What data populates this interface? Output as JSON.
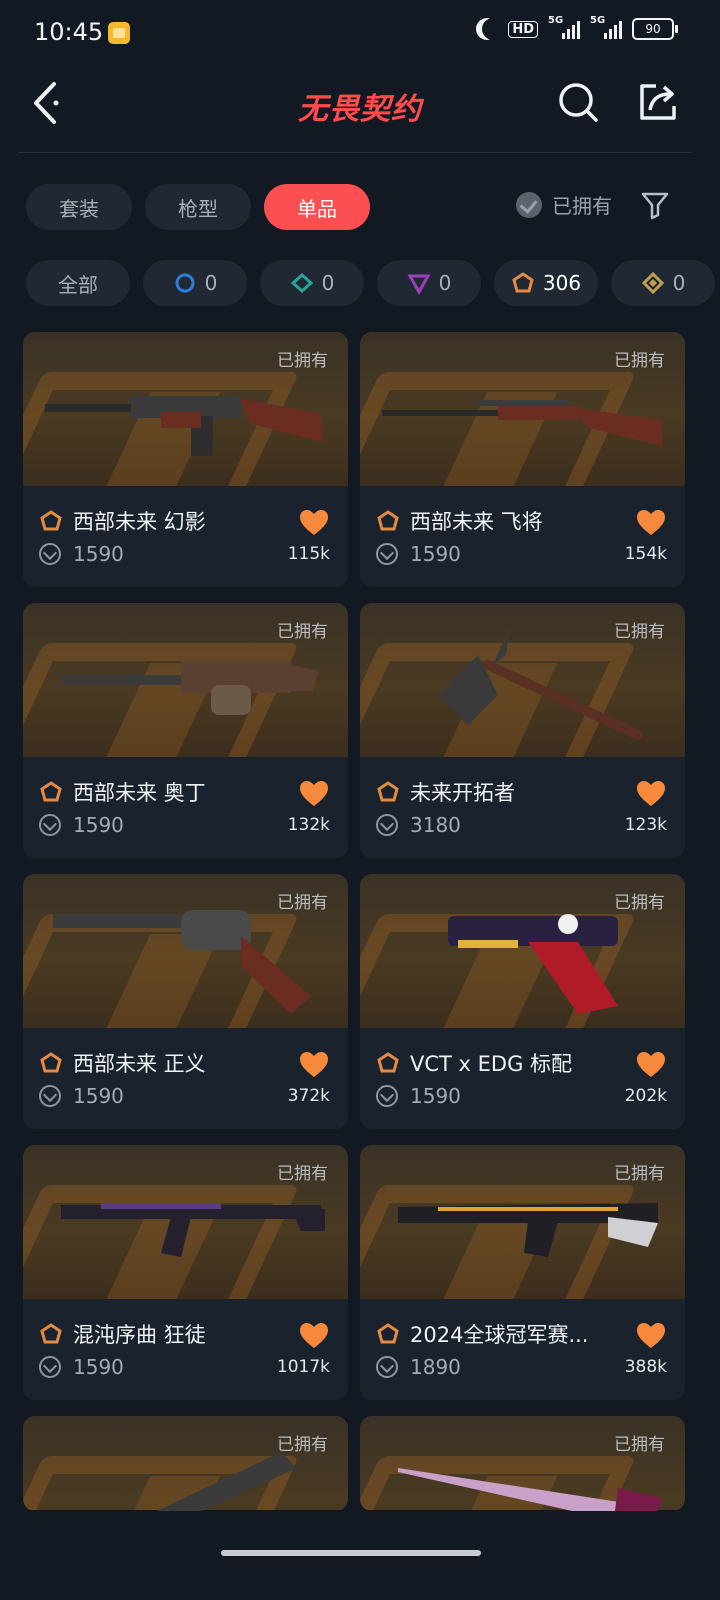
{
  "status_bar": {
    "time": "10:45",
    "hd": "HD",
    "sig1": "5G",
    "sig2": "5G",
    "battery": "90"
  },
  "header": {
    "title": "无畏契约"
  },
  "tabs": [
    {
      "label": "套装",
      "active": false
    },
    {
      "label": "枪型",
      "active": false
    },
    {
      "label": "单品",
      "active": true
    }
  ],
  "owned_filter": {
    "label": "已拥有"
  },
  "tiers": [
    {
      "label": "全部",
      "count": ""
    },
    {
      "label": "",
      "count": "0",
      "color": "#2f7fd6"
    },
    {
      "label": "",
      "count": "0",
      "color": "#2aa39a"
    },
    {
      "label": "",
      "count": "0",
      "color": "#9c3fb8"
    },
    {
      "label": "",
      "count": "306",
      "color": "#e48a43"
    },
    {
      "label": "",
      "count": "0",
      "color": "#c0a050"
    }
  ],
  "items": [
    {
      "owned": "已拥有",
      "name": "西部未来 幻影",
      "price": "1590",
      "likes": "115k",
      "weapon": "rifle-icon"
    },
    {
      "owned": "已拥有",
      "name": "西部未来 飞将",
      "price": "1590",
      "likes": "154k",
      "weapon": "sniper-icon"
    },
    {
      "owned": "已拥有",
      "name": "西部未来 奥丁",
      "price": "1590",
      "likes": "132k",
      "weapon": "machinegun-icon"
    },
    {
      "owned": "已拥有",
      "name": "未来开拓者",
      "price": "3180",
      "likes": "123k",
      "weapon": "axe-icon"
    },
    {
      "owned": "已拥有",
      "name": "西部未来 正义",
      "price": "1590",
      "likes": "372k",
      "weapon": "revolver-icon"
    },
    {
      "owned": "已拥有",
      "name": "VCT x EDG 标配",
      "price": "1590",
      "likes": "202k",
      "weapon": "pistol-icon"
    },
    {
      "owned": "已拥有",
      "name": "混沌序曲 狂徒",
      "price": "1590",
      "likes": "1017k",
      "weapon": "assault-rifle-icon"
    },
    {
      "owned": "已拥有",
      "name": "2024全球冠军赛...",
      "price": "1890",
      "likes": "388k",
      "weapon": "smg-icon"
    },
    {
      "owned": "已拥有",
      "weapon": "knife-icon"
    },
    {
      "owned": "已拥有",
      "weapon": "blade-icon"
    }
  ],
  "colors": {
    "accent": "#fb4f52",
    "heart": "#f7893c",
    "tier_premium": "#e48a43"
  }
}
